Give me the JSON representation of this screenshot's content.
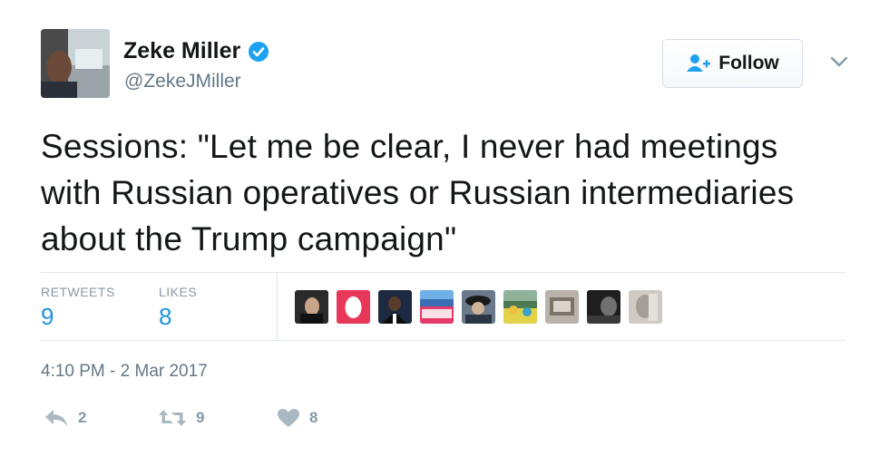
{
  "author": {
    "name": "Zeke Miller",
    "handle": "@ZekeJMiller",
    "verified": true
  },
  "follow_label": "Follow",
  "tweet_text": "Sessions: \"Let me be clear, I never had meetings with Russian operatives or Russian intermediaries about the Trump campaign\"",
  "stats": {
    "retweets_label": "RETWEETS",
    "retweets_value": "9",
    "likes_label": "LIKES",
    "likes_value": "8"
  },
  "timestamp": "4:10 PM - 2 Mar 2017",
  "actions": {
    "reply_count": "2",
    "retweet_count": "9",
    "like_count": "8"
  },
  "colors": {
    "link_blue": "#1b95e0",
    "muted": "#657786",
    "verified_blue": "#1da1f2",
    "action_gray": "#aab8c2"
  },
  "liker_avatar_count": 9
}
